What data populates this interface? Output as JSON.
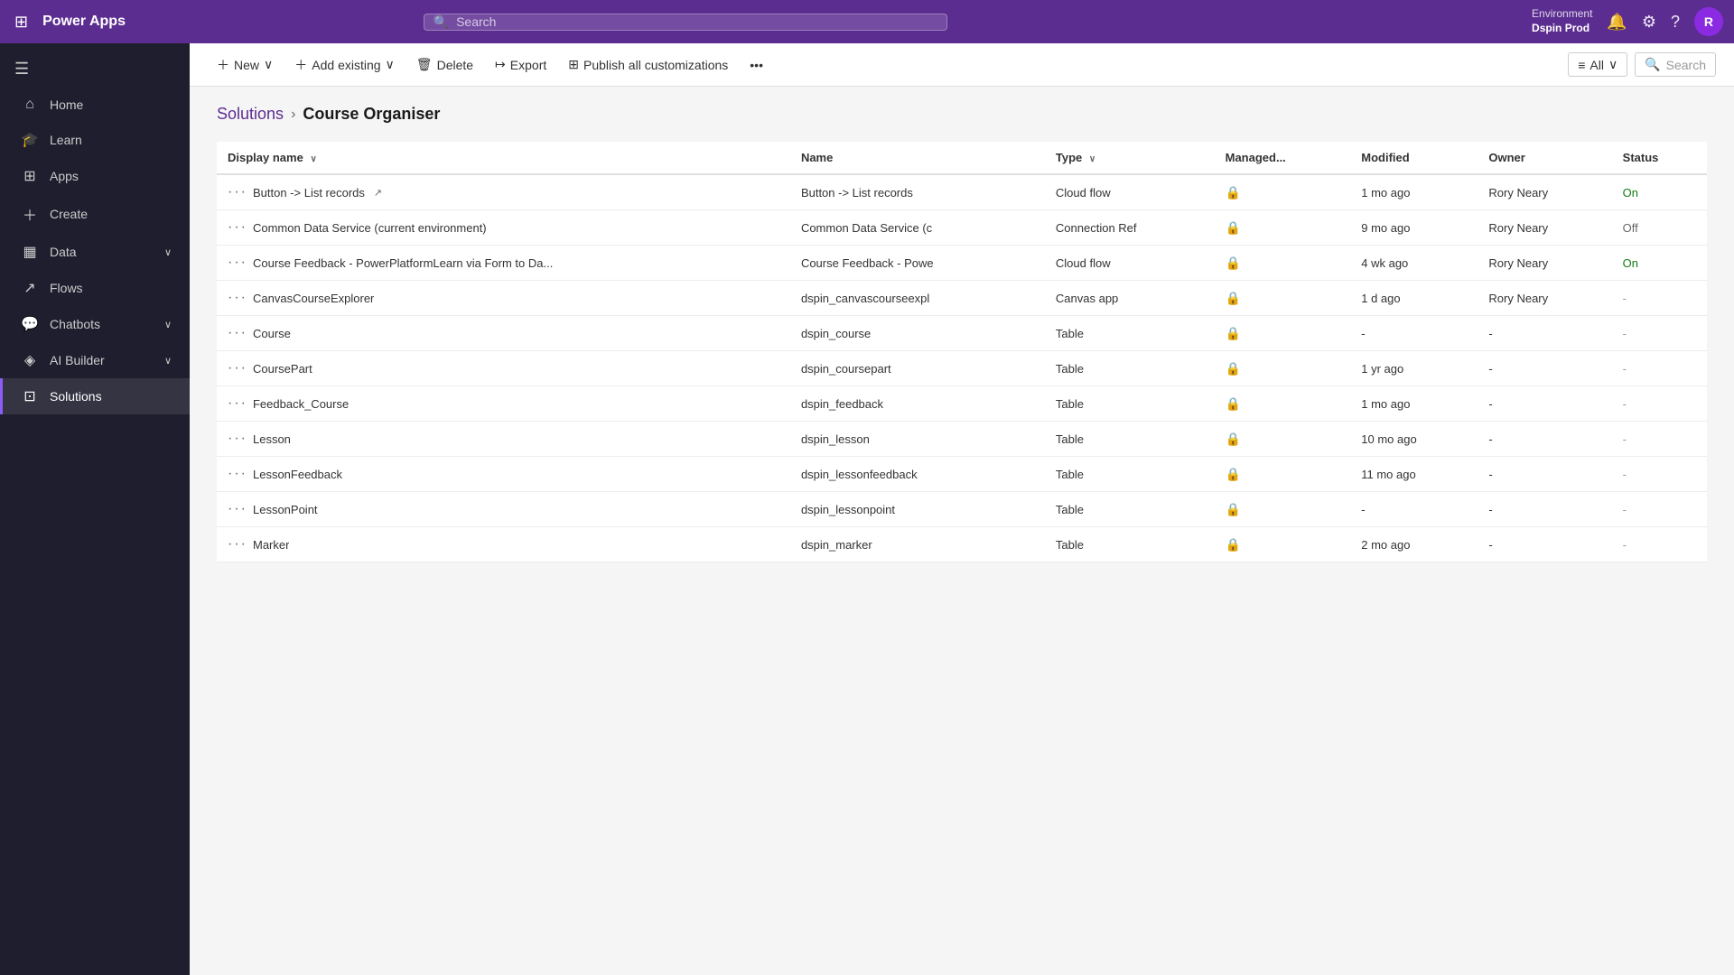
{
  "topBar": {
    "appName": "Power Apps",
    "searchPlaceholder": "Search",
    "environment": {
      "label": "Environment",
      "name": "Dspin Prod"
    },
    "avatarInitial": "R"
  },
  "sidebar": {
    "toggleIcon": "☰",
    "items": [
      {
        "id": "home",
        "icon": "⌂",
        "label": "Home",
        "active": false,
        "hasChevron": false
      },
      {
        "id": "learn",
        "icon": "🎓",
        "label": "Learn",
        "active": false,
        "hasChevron": false
      },
      {
        "id": "apps",
        "icon": "⊞",
        "label": "Apps",
        "active": false,
        "hasChevron": false
      },
      {
        "id": "create",
        "icon": "＋",
        "label": "Create",
        "active": false,
        "hasChevron": false
      },
      {
        "id": "data",
        "icon": "⊟",
        "label": "Data",
        "active": false,
        "hasChevron": true
      },
      {
        "id": "flows",
        "icon": "⤷",
        "label": "Flows",
        "active": false,
        "hasChevron": false
      },
      {
        "id": "chatbots",
        "icon": "💬",
        "label": "Chatbots",
        "active": false,
        "hasChevron": true
      },
      {
        "id": "ai-builder",
        "icon": "🤖",
        "label": "AI Builder",
        "active": false,
        "hasChevron": true
      },
      {
        "id": "solutions",
        "icon": "⊡",
        "label": "Solutions",
        "active": true,
        "hasChevron": false
      }
    ]
  },
  "commandBar": {
    "newLabel": "New",
    "newChevron": "∨",
    "addExistingLabel": "Add existing",
    "addExistingChevron": "∨",
    "deleteLabel": "Delete",
    "exportLabel": "Export",
    "publishLabel": "Publish all customizations",
    "moreIcon": "•••",
    "filterLabel": "All",
    "filterChevron": "∨",
    "searchPlaceholder": "Search"
  },
  "breadcrumb": {
    "parent": "Solutions",
    "separator": "›",
    "current": "Course Organiser"
  },
  "table": {
    "columns": [
      {
        "id": "display-name",
        "label": "Display name",
        "sortable": true
      },
      {
        "id": "name",
        "label": "Name",
        "sortable": false
      },
      {
        "id": "type",
        "label": "Type",
        "sortable": true
      },
      {
        "id": "managed",
        "label": "Managed...",
        "sortable": false
      },
      {
        "id": "modified",
        "label": "Modified",
        "sortable": false
      },
      {
        "id": "owner",
        "label": "Owner",
        "sortable": false
      },
      {
        "id": "status",
        "label": "Status",
        "sortable": false
      }
    ],
    "rows": [
      {
        "displayName": "Button -> List records",
        "hasExtLink": true,
        "name": "Button -> List records",
        "type": "Cloud flow",
        "managed": true,
        "modified": "1 mo ago",
        "owner": "Rory Neary",
        "status": "On",
        "statusClass": "status-on"
      },
      {
        "displayName": "Common Data Service (current environment)",
        "hasExtLink": false,
        "name": "Common Data Service (c",
        "nameTruncated": true,
        "type": "Connection Ref",
        "managed": true,
        "modified": "9 mo ago",
        "owner": "Rory Neary",
        "status": "Off",
        "statusClass": "status-off"
      },
      {
        "displayName": "Course Feedback - PowerPlatformLearn via Form to Da...",
        "hasExtLink": false,
        "name": "Course Feedback - Powe",
        "nameTruncated": true,
        "type": "Cloud flow",
        "managed": true,
        "modified": "4 wk ago",
        "owner": "Rory Neary",
        "status": "On",
        "statusClass": "status-on"
      },
      {
        "displayName": "CanvasCourseExplorer",
        "hasExtLink": false,
        "name": "dspin_canvascourseexpl",
        "nameTruncated": true,
        "type": "Canvas app",
        "managed": true,
        "modified": "1 d ago",
        "owner": "Rory Neary",
        "status": "-",
        "statusClass": "status-dash"
      },
      {
        "displayName": "Course",
        "hasExtLink": false,
        "name": "dspin_course",
        "type": "Table",
        "managed": true,
        "modified": "-",
        "owner": "-",
        "status": "-",
        "statusClass": "status-dash"
      },
      {
        "displayName": "CoursePart",
        "hasExtLink": false,
        "name": "dspin_coursepart",
        "type": "Table",
        "managed": true,
        "modified": "1 yr ago",
        "owner": "-",
        "status": "-",
        "statusClass": "status-dash"
      },
      {
        "displayName": "Feedback_Course",
        "hasExtLink": false,
        "name": "dspin_feedback",
        "type": "Table",
        "managed": true,
        "modified": "1 mo ago",
        "owner": "-",
        "status": "-",
        "statusClass": "status-dash"
      },
      {
        "displayName": "Lesson",
        "hasExtLink": false,
        "name": "dspin_lesson",
        "type": "Table",
        "managed": true,
        "modified": "10 mo ago",
        "owner": "-",
        "status": "-",
        "statusClass": "status-dash"
      },
      {
        "displayName": "LessonFeedback",
        "hasExtLink": false,
        "name": "dspin_lessonfeedback",
        "type": "Table",
        "managed": true,
        "modified": "11 mo ago",
        "owner": "-",
        "status": "-",
        "statusClass": "status-dash"
      },
      {
        "displayName": "LessonPoint",
        "hasExtLink": false,
        "name": "dspin_lessonpoint",
        "type": "Table",
        "managed": true,
        "modified": "-",
        "owner": "-",
        "status": "-",
        "statusClass": "status-dash"
      },
      {
        "displayName": "Marker",
        "hasExtLink": false,
        "name": "dspin_marker",
        "type": "Table",
        "managed": true,
        "modified": "2 mo ago",
        "owner": "-",
        "status": "-",
        "statusClass": "status-dash"
      }
    ]
  }
}
